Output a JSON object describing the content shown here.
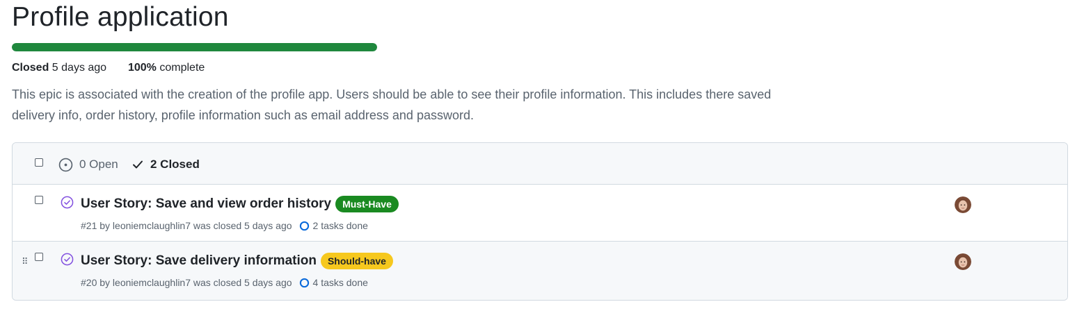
{
  "milestone": {
    "title": "Profile application",
    "progress_percent": 100,
    "closed_label": "Closed",
    "closed_when": "5 days ago",
    "complete_percent": "100%",
    "complete_label": "complete",
    "description": "This epic is associated with the creation of the profile app. Users should be able to see their profile information. This includes there saved delivery info, order history, profile information such as email address and password."
  },
  "issues_header": {
    "open_label": "0 Open",
    "closed_label": "2 Closed"
  },
  "issues": [
    {
      "title": "User Story: Save and view order history",
      "label": "Must-Have",
      "label_color": "#1a8a21",
      "meta": "#21 by leoniemclaughlin7 was closed 5 days ago",
      "tasks": "2 tasks done",
      "status_icon": "closed-issue-icon"
    },
    {
      "title": "User Story: Save delivery information",
      "label": "Should-have",
      "label_color": "#f6c81e",
      "meta": "#20 by leoniemclaughlin7 was closed 5 days ago",
      "tasks": "4 tasks done",
      "status_icon": "closed-issue-icon"
    }
  ],
  "colors": {
    "progress": "#1f883d",
    "closed_icon": "#8250df",
    "tasks_icon": "#0969da"
  }
}
